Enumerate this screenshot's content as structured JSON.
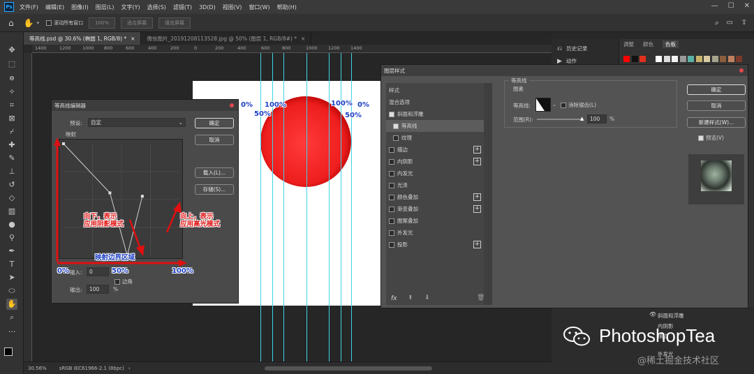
{
  "app": {
    "logo_text": "Ps"
  },
  "menu": [
    "文件(F)",
    "编辑(E)",
    "图像(I)",
    "图层(L)",
    "文字(Y)",
    "选择(S)",
    "滤镜(T)",
    "3D(D)",
    "视图(V)",
    "窗口(W)",
    "帮助(H)"
  ],
  "options_bar": {
    "scroll_all_label": "滚动所有窗口",
    "zoom_btn": "100%",
    "fit_btn": "适合屏幕",
    "fill_btn": "填充屏幕"
  },
  "tabs": [
    {
      "label": "等高线.psd @ 30.6% (椭圆 1, RGB/8) *",
      "active": true
    },
    {
      "label": "微信图片_20191208113528.jpg @ 50% (图层 1, RGB/8#) *",
      "active": false
    }
  ],
  "ruler_labels": [
    "1400",
    "1200",
    "1000",
    "800",
    "600",
    "400",
    "200",
    "0",
    "200",
    "400",
    "600",
    "800",
    "1000",
    "1200",
    "1400"
  ],
  "canvas_annotations": {
    "left_0": "0%",
    "left_50": "50%",
    "left_100": "100%",
    "right_100": "100%",
    "right_0": "0%",
    "right_50": "50%"
  },
  "status": {
    "zoom": "30.56%",
    "profile": "sRGB IEC61966-2.1 (8bpc)"
  },
  "right_panel": {
    "history_label": "历史记录",
    "actions_label": "动作",
    "tabs": [
      "调整",
      "颜色",
      "色板"
    ],
    "swatches": [
      "#ff0000",
      "#111111",
      "#e0301e",
      "#333333",
      "#ffffff",
      "#dddddd",
      "#f2f2f2",
      "#999999",
      "#5bb0a6",
      "#c7b16a",
      "#d9c9a0",
      "#a5a38b",
      "#8a5d3b",
      "#c08060",
      "#7a3a2a"
    ]
  },
  "contour_editor": {
    "title": "等高线编辑器",
    "preset_label": "预设:",
    "preset_value": "自定",
    "mapping_label": "映射",
    "ok": "确定",
    "cancel": "取消",
    "load": "载入(L)...",
    "save": "存储(S)...",
    "input_label": "输入:",
    "input_value": "0",
    "output_label": "输出:",
    "output_value": "100",
    "percent": "%",
    "corner_label": "边角",
    "note_down": "向下，表示\n应用阴影模式",
    "note_up": "向上，表示\n应用高光模式",
    "note_boundary": "映射边界区域",
    "axis_0": "0%",
    "axis_50": "50%",
    "axis_100": "100%",
    "curve_points": [
      {
        "input": 0,
        "output": 100
      },
      {
        "input": 40,
        "output": 56
      },
      {
        "input": 55,
        "output": 0
      },
      {
        "input": 68,
        "output": 53
      }
    ]
  },
  "layer_style": {
    "title": "图层样式",
    "items": [
      {
        "label": "样式",
        "check": null,
        "plus": false,
        "sel": false
      },
      {
        "label": "混合选项",
        "check": null,
        "plus": false,
        "sel": false
      },
      {
        "label": "斜面和浮雕",
        "check": true,
        "plus": false,
        "sel": false
      },
      {
        "label": "等高线",
        "check": true,
        "plus": false,
        "sel": true,
        "indent": true
      },
      {
        "label": "纹理",
        "check": false,
        "plus": false,
        "sel": false,
        "indent": true
      },
      {
        "label": "描边",
        "check": false,
        "plus": true,
        "sel": false
      },
      {
        "label": "内阴影",
        "check": false,
        "plus": true,
        "sel": false
      },
      {
        "label": "内发光",
        "check": false,
        "plus": false,
        "sel": false
      },
      {
        "label": "光泽",
        "check": false,
        "plus": false,
        "sel": false
      },
      {
        "label": "颜色叠加",
        "check": false,
        "plus": true,
        "sel": false
      },
      {
        "label": "渐变叠加",
        "check": false,
        "plus": true,
        "sel": false
      },
      {
        "label": "图案叠加",
        "check": false,
        "plus": false,
        "sel": false
      },
      {
        "label": "外发光",
        "check": false,
        "plus": false,
        "sel": false
      },
      {
        "label": "投影",
        "check": false,
        "plus": true,
        "sel": false
      }
    ],
    "section_title": "等高线",
    "group_title": "图素",
    "contour_label": "等高线:",
    "antialias_label": "消除锯齿(L)",
    "range_label": "范围(R):",
    "range_value": "100",
    "range_unit": "%",
    "ok": "确定",
    "cancel": "取消",
    "new_style": "新建样式(W)...",
    "preview_label": "预览(V)",
    "fx": "fx"
  },
  "layers_bottom": {
    "items": [
      "斜面和浮雕",
      "内阴影",
      "描边",
      "外发光"
    ]
  },
  "watermark": {
    "brand": "PhotoshopTea",
    "community": "@稀土掘金技术社区"
  }
}
